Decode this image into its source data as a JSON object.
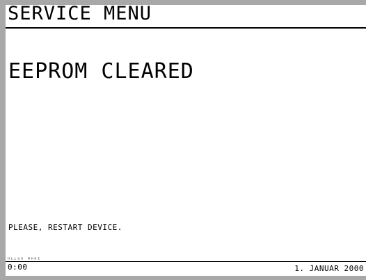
{
  "header": {
    "title": "SERVICE MENU"
  },
  "main": {
    "status_message": "EEPROM CLEARED",
    "hint": "PLEASE, RESTART DEVICE."
  },
  "footer": {
    "scribble": "ᴴᴸᴸᵁᴳ ᴹᴴᴴᴵ",
    "time": "0:00",
    "date": "1. JANUAR 2000"
  }
}
